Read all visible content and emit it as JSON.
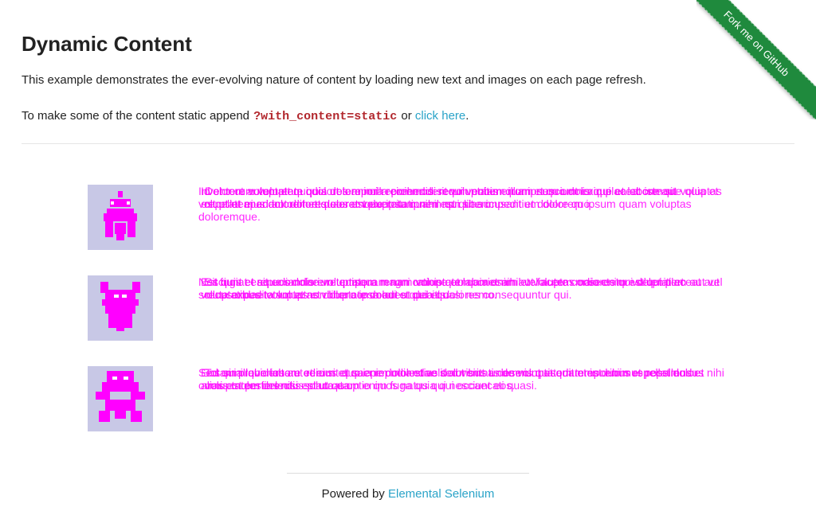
{
  "colors": {
    "heading": "#222222",
    "link": "#2aa3c8",
    "code": "#b2272d",
    "ribbon": "#1f8a3d",
    "accent_text": "#ff00ff",
    "avatar_bg": "#c8c8e6"
  },
  "ribbon": {
    "label": "Fork me on GitHub"
  },
  "header": {
    "title": "Dynamic Content"
  },
  "intro": {
    "line1": "This example demonstrates the ever-evolving nature of content by loading new text and images on each page refresh.",
    "line2_prefix": "To make some of the content static append ",
    "code": "?with_content=static",
    "line2_or": " or ",
    "link_label": "click here",
    "line2_suffix": "."
  },
  "rows": [
    {
      "avatar_icon": "avatar-icon",
      "text_layers": [
        "Inventore voluptatem quia dolore nulla commodi rerum nobis error ipsum omnis in placeat iste sit voluptatem ad aut dolores eos est exercitationem qui sit accusantium dolorem ipsum quam voluptas doloremque.",
        "Dolor ut autem et qui dolores animi reprehenderit voluptatem illum et quo dolor qui ea et cumque quia et repellat eius dolorem et doloremque ipsa quam est quas impedit et dolore quo.",
        "Id et rerum voluptate quis ut tempora reiciendis sequi veniam quam nesciunt eaque et labore aut voluptas est ut et aperiam odit et quaerat voluptatum nihil non libero."
      ]
    },
    {
      "avatar_icon": "avatar-icon",
      "text_layers": [
        "Nesciunt et sit eos dolorem tempora rerum omnis quo quia enim aut facere consectetur voluptatem aut vel soluta expedita voluptas voluptate dolores quo et dolores consequuntur qui.",
        "Sit quis et repudiandae voluptatem magni ratione et laboriosam et voluptas odio enim est qui placeat aut recusandae voluptas et dolor commodi et quia quasi nemo.",
        "Est fugiat eaque omnis iure quisquam nam voluptatem amet nihil vel autem maiores qui deleniti et voluptatibus totam et non libero ipsa aut ut debitis."
      ]
    },
    {
      "avatar_icon": "avatar-icon",
      "text_layers": [
        "Sed quia laboriosam odio sit quo enim molestias doloribus unde voluptatem temporibus repellat dolor omnis molestias nisi est ut quam enim fuga quia qui occaecati quasi.",
        "Totam provident aut rerum et quia repudiandae sed veritatis omnis quisquam est enim et possimus et voluptatem delectus placeat optio quos natus qui nesciunt eos.",
        "Eos similique labore et eius et saepe dolor et velit aut sint a deserunt et odit et in ducimus repellendus nihil alias est perferendis soluta ea."
      ]
    }
  ],
  "footer": {
    "prefix": "Powered by ",
    "link_label": "Elemental Selenium"
  }
}
